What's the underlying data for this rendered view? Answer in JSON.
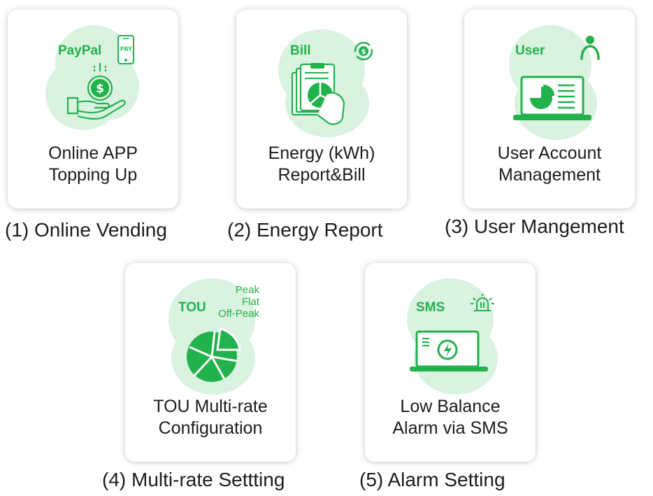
{
  "brand_color": "#22b24c",
  "cards": [
    {
      "icon": "online-payment-icon",
      "tags": [
        "PayPal",
        "PAY"
      ],
      "title": [
        "Online APP",
        "Topping Up"
      ],
      "caption": "(1) Online Vending"
    },
    {
      "icon": "bill-report-icon",
      "tags": [
        "Bill"
      ],
      "title": [
        "Energy (kWh)",
        "Report&Bill"
      ],
      "caption": "(2) Energy Report"
    },
    {
      "icon": "user-laptop-icon",
      "tags": [
        "User"
      ],
      "title": [
        "User Account",
        "Management"
      ],
      "caption": "(3) User Mangement"
    },
    {
      "icon": "tou-pie-icon",
      "tags": [
        "TOU",
        "Peak",
        "Flat",
        "Off-Peak"
      ],
      "title": [
        "TOU Multi-rate",
        "Configuration"
      ],
      "caption": "(4) Multi-rate Settting"
    },
    {
      "icon": "sms-alarm-laptop-icon",
      "tags": [
        "SMS"
      ],
      "title": [
        "Low Balance",
        "Alarm via SMS"
      ],
      "caption": "(5) Alarm Setting"
    }
  ]
}
